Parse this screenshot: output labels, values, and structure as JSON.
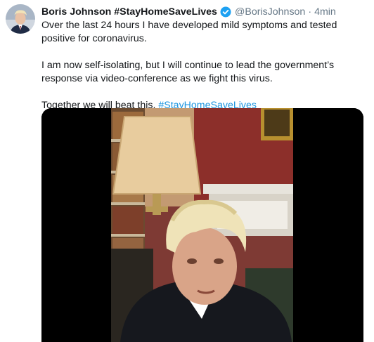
{
  "tweet": {
    "display_name": "Boris Johnson #StayHomeSaveLives",
    "handle": "@BorisJohnson",
    "separator": "·",
    "time": "4min",
    "verified_icon": "verified-badge-icon",
    "paragraph1": "Over the last 24 hours I have developed mild symptoms and tested positive for coronavirus.",
    "paragraph2": "I am now self-isolating, but I will continue to lead the government’s response via video-conference as we fight this virus.",
    "paragraph3_text": "Together we will beat this. ",
    "paragraph3_hashtag": "#StayHomeSaveLives"
  },
  "colors": {
    "link": "#1b95e0",
    "verified": "#1da1f2",
    "secondary_text": "#657786"
  }
}
